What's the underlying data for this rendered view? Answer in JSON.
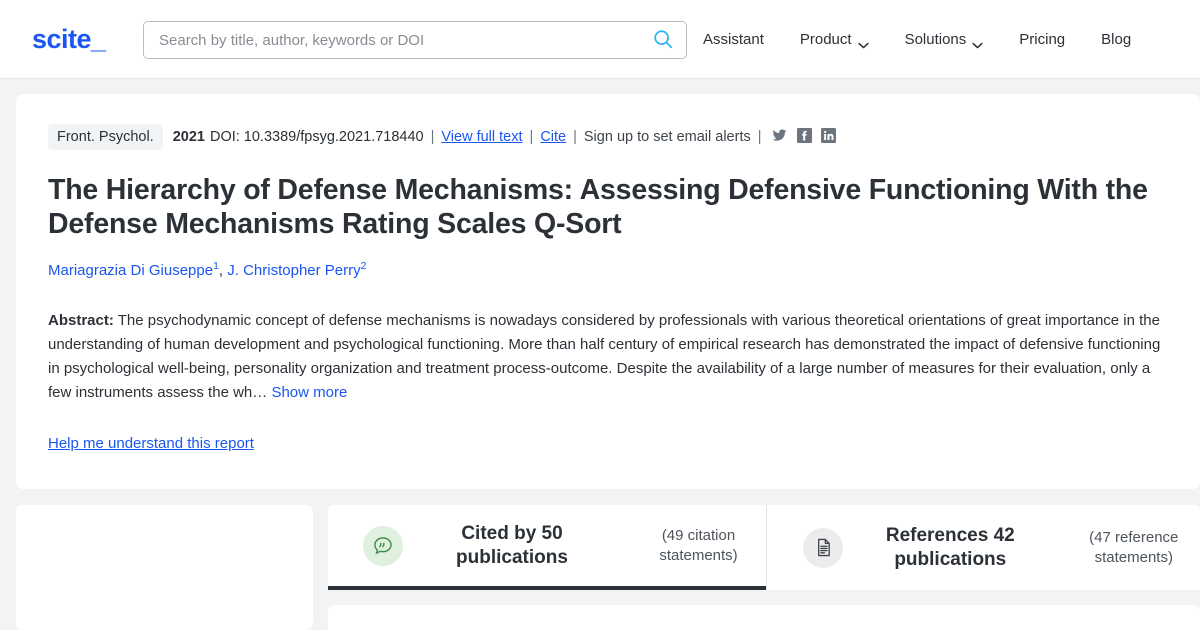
{
  "header": {
    "logo_text": "scite_",
    "search": {
      "placeholder": "Search by title, author, keywords or DOI",
      "value": "",
      "icon": "search-icon"
    },
    "nav": [
      {
        "label": "Assistant",
        "has_chevron": false
      },
      {
        "label": "Product",
        "has_chevron": true
      },
      {
        "label": "Solutions",
        "has_chevron": true
      },
      {
        "label": "Pricing",
        "has_chevron": false
      },
      {
        "label": "Blog",
        "has_chevron": false
      }
    ]
  },
  "paper": {
    "journal": "Front. Psychol.",
    "year": "2021",
    "doi": "DOI: 10.3389/fpsyg.2021.718440",
    "view_full_text": "View full text",
    "cite": "Cite",
    "email_alerts": "Sign up to set email alerts",
    "separator": "|",
    "socials": [
      {
        "name": "twitter-icon",
        "label": "Twitter"
      },
      {
        "name": "facebook-icon",
        "label": "Facebook"
      },
      {
        "name": "linkedin-icon",
        "label": "LinkedIn"
      }
    ],
    "title": "The Hierarchy of Defense Mechanisms: Assessing Defensive Functioning With the Defense Mechanisms Rating Scales Q-Sort",
    "authors": [
      {
        "name": "Mariagrazia Di Giuseppe",
        "affiliation": "1"
      },
      {
        "name": "J. Christopher Perry",
        "affiliation": "2"
      }
    ],
    "abstract_label": "Abstract:",
    "abstract_text": "The psychodynamic concept of defense mechanisms is nowadays considered by professionals with various theoretical orientations of great importance in the understanding of human development and psychological functioning. More than half century of empirical research has demonstrated the impact of defensive functioning in psychological well-being, personality organization and treatment process-outcome. Despite the availability of a large number of measures for their evaluation, only a few instruments assess the wh…",
    "show_more": "Show more",
    "help_link": "Help me understand this report"
  },
  "tabs": [
    {
      "id": "cited-by",
      "icon": "quote-bubble-icon",
      "label": "Cited by 50 publications",
      "sub": "(49 citation statements)",
      "active": true
    },
    {
      "id": "references",
      "icon": "document-icon",
      "label": "References 42 publications",
      "sub": "(47 reference statements)",
      "active": false
    }
  ],
  "colors": {
    "brand_blue": "#1a56f0",
    "search_icon_blue": "#29b6f6",
    "text_dark": "#2b3137",
    "page_bg": "#f2f3f4",
    "cited_icon_green": "#3c8c46",
    "cited_icon_bg": "#dff0df",
    "refs_icon_bg": "#ececec",
    "active_tab_border": "#2b3137"
  }
}
